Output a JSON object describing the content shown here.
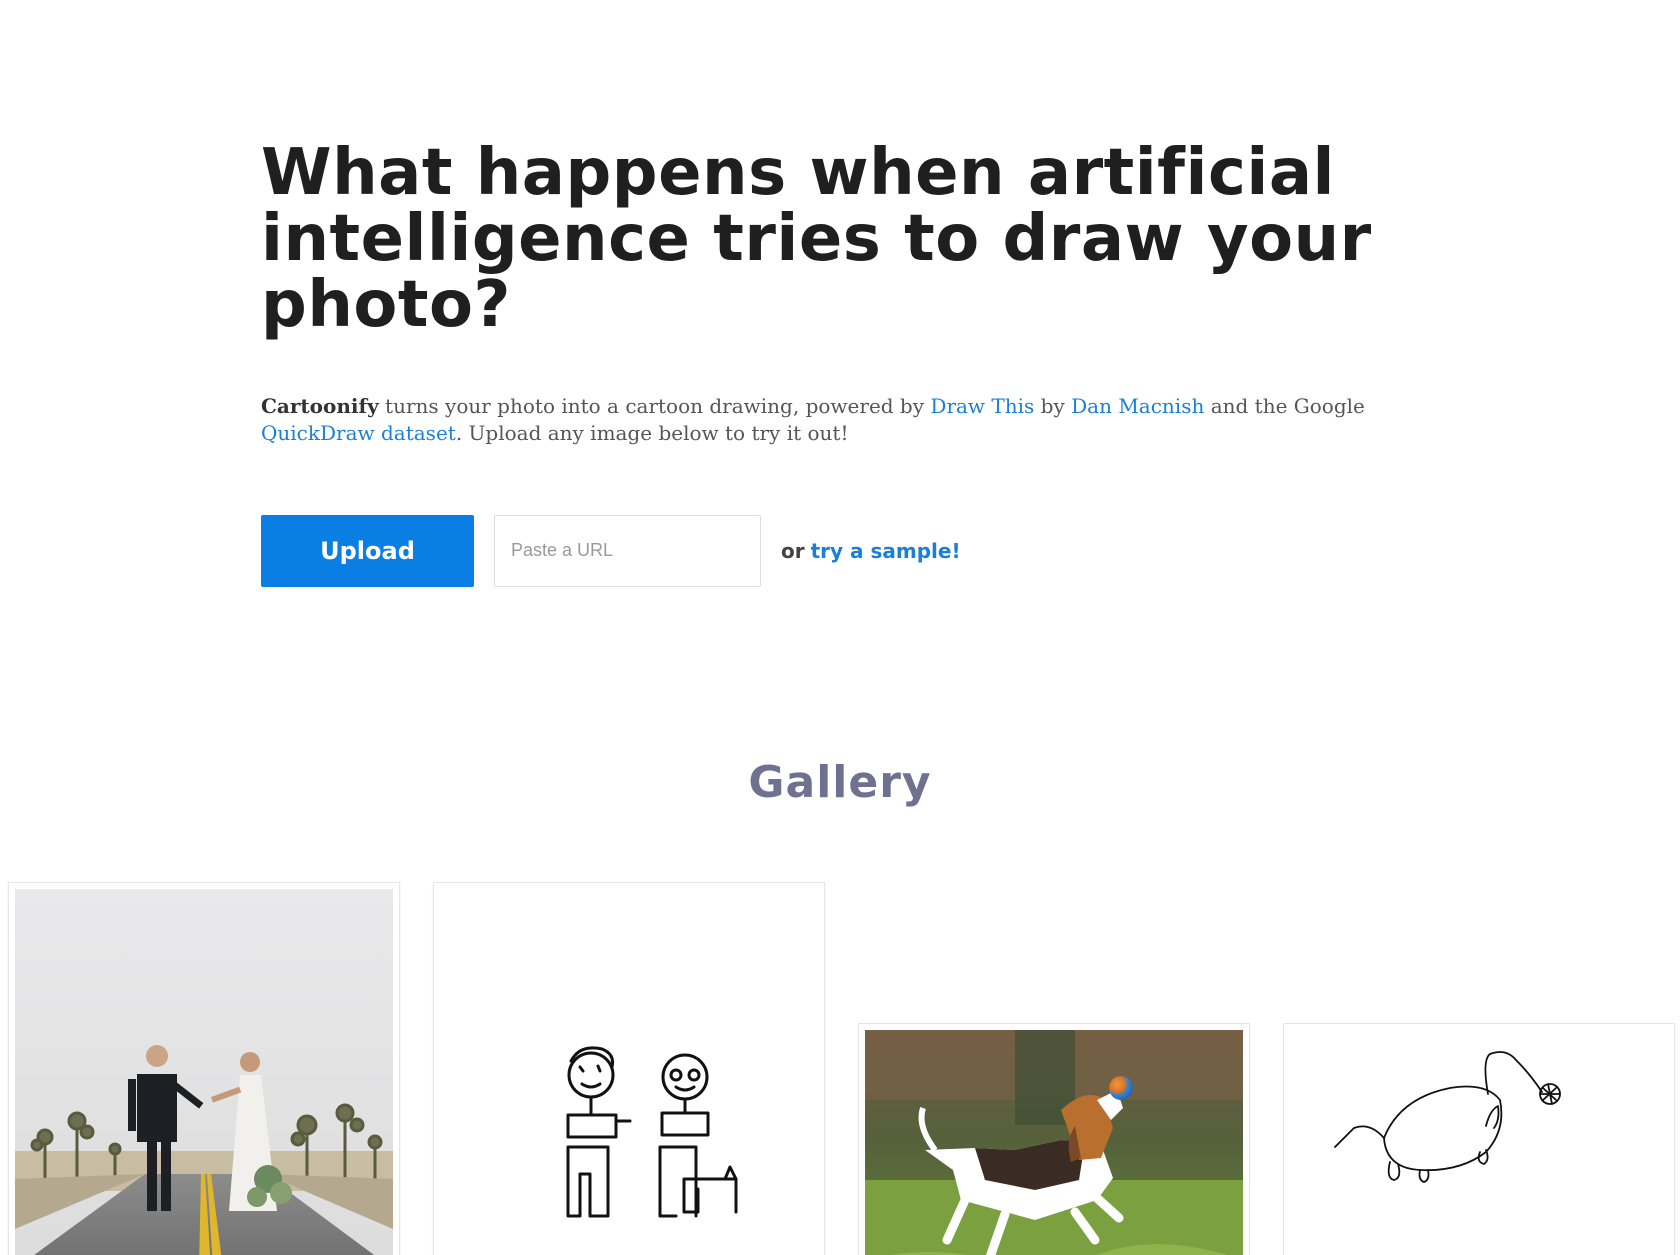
{
  "hero": {
    "headline": "What happens when artificial intelligence tries to draw your photo?",
    "intro": {
      "brand": "Cartoonify",
      "text_1": " turns your photo into a cartoon drawing, powered by ",
      "link_draw_this": "Draw This",
      "text_2": " by ",
      "link_author": "Dan Macnish",
      "text_3": " and the Google ",
      "link_dataset": "QuickDraw dataset",
      "text_4": ". Upload any image below to try it out!"
    }
  },
  "actions": {
    "upload_label": "Upload",
    "url_placeholder": "Paste a URL",
    "url_value": "",
    "or_text": "or",
    "sample_link": "try a sample!"
  },
  "gallery": {
    "title": "Gallery"
  },
  "colors": {
    "accent": "#0a7ee3",
    "link": "#1b7fd8",
    "gallery_title": "#6f7191",
    "headline": "#1f1f1f"
  }
}
